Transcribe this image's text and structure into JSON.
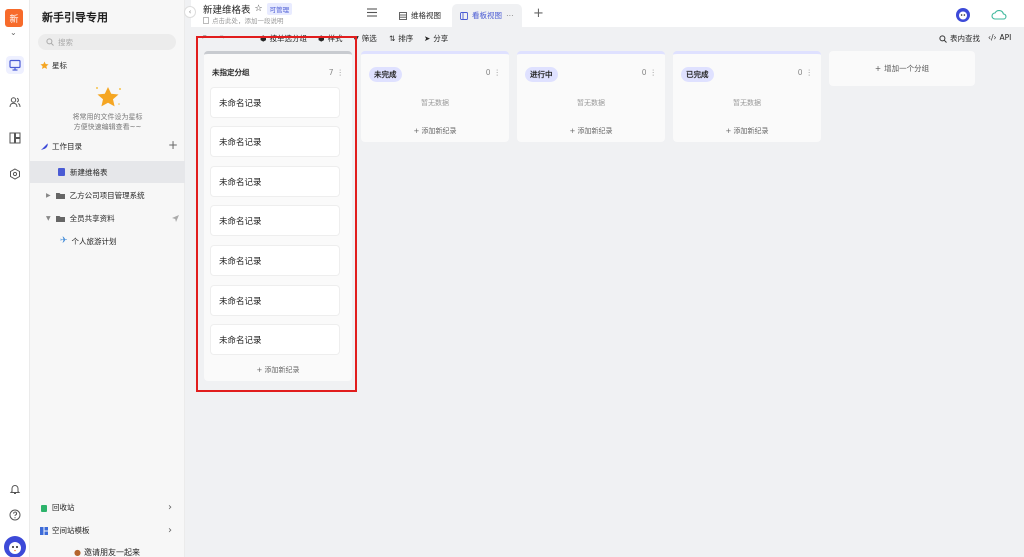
{
  "rail": {
    "logo": "新"
  },
  "sidebar": {
    "title": "新手引导专用",
    "search_placeholder": "搜索",
    "starred_label": "星标",
    "starred_empty_line1": "将常用的文件设为星标",
    "starred_empty_line2": "方便快速编辑查看~~",
    "directory_label": "工作目录",
    "items": [
      {
        "label": "新建维格表"
      },
      {
        "label": "乙方公司项目管理系统"
      },
      {
        "label": "全员共享资料"
      },
      {
        "label": "个人旅游计划"
      }
    ],
    "recycle_label": "回收站",
    "template_label": "空间站模板",
    "invite_label": "邀请朋友一起来"
  },
  "header": {
    "doc_title": "新建维格表",
    "permission_badge": "可管理",
    "description": "点击此处，添加一段说明",
    "tabs": [
      {
        "label": "维格视图"
      },
      {
        "label": "看板视图"
      }
    ]
  },
  "toolbar": {
    "group_by": "按单选分组",
    "style": "样式",
    "filter": "筛选",
    "sort": "排序",
    "share": "分享",
    "find_in_table": "表内查找",
    "api": "API"
  },
  "board": {
    "columns": [
      {
        "title": "未指定分组",
        "count": "7",
        "cards": [
          "未命名记录",
          "未命名记录",
          "未命名记录",
          "未命名记录",
          "未命名记录",
          "未命名记录",
          "未命名记录"
        ],
        "add_label": "添加新纪录"
      },
      {
        "title": "未完成",
        "count": "0",
        "empty_label": "暂无数据",
        "add_label": "添加新纪录"
      },
      {
        "title": "进行中",
        "count": "0",
        "empty_label": "暂无数据",
        "add_label": "添加新纪录"
      },
      {
        "title": "已完成",
        "count": "0",
        "empty_label": "暂无数据",
        "add_label": "添加新纪录"
      }
    ],
    "add_group_label": "增加一个分组"
  },
  "colors": {
    "accent": "#4a5bd4",
    "highlight_border": "#e11d1d",
    "pill_uncompleted": "#dfe1ff",
    "pill_in_progress": "#dfe1ff",
    "pill_completed": "#dfe1ff"
  }
}
